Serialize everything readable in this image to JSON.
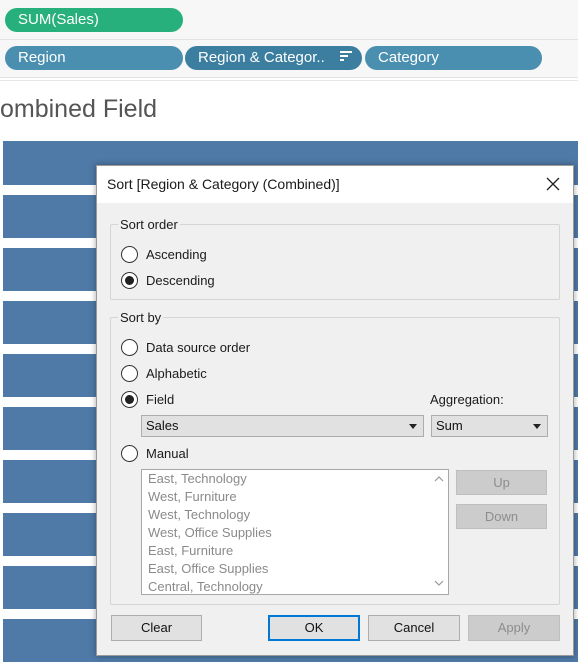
{
  "shelves": {
    "measures": [
      "SUM(Sales)"
    ],
    "dimensions": [
      "Region",
      "Region & Categor..",
      "Category"
    ]
  },
  "viz": {
    "title": "ombined Field"
  },
  "dialog": {
    "title": "Sort [Region & Category (Combined)]",
    "sort_order": {
      "label": "Sort order",
      "options": [
        {
          "label": "Ascending",
          "checked": false
        },
        {
          "label": "Descending",
          "checked": true
        }
      ]
    },
    "sort_by": {
      "label": "Sort by",
      "options": {
        "data_source_order": {
          "label": "Data source order",
          "checked": false
        },
        "alphabetic": {
          "label": "Alphabetic",
          "checked": false
        },
        "field": {
          "label": "Field",
          "checked": true
        },
        "manual": {
          "label": "Manual",
          "checked": false
        }
      },
      "field_select": "Sales",
      "aggregation_label": "Aggregation:",
      "aggregation_select": "Sum",
      "manual_items": [
        "East, Technology",
        "West, Furniture",
        "West, Technology",
        "West, Office Supplies",
        "East, Furniture",
        "East, Office Supplies",
        "Central, Technology"
      ],
      "up_button": "Up",
      "down_button": "Down"
    },
    "buttons": {
      "clear": "Clear",
      "ok": "OK",
      "cancel": "Cancel",
      "apply": "Apply"
    }
  },
  "icons": {
    "close": "close-icon",
    "sort": "sort-descending-icon",
    "scroll_up": "chevron-up-icon",
    "scroll_down": "chevron-down-icon"
  },
  "colors": {
    "measure_pill": "#27b07b",
    "dimension_pill": "#4a8fb0",
    "bar_fill": "#4f79a6",
    "primary_border": "#0078d7"
  }
}
